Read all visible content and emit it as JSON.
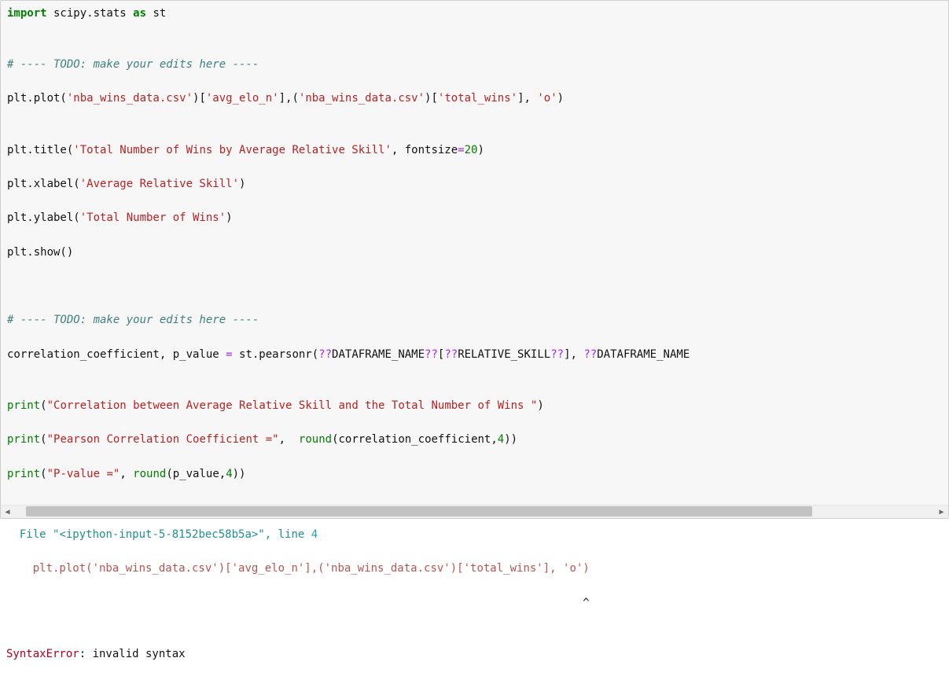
{
  "code": {
    "l1_import": "import",
    "l1_mod": " scipy.stats ",
    "l1_as": "as",
    "l1_alias": " st",
    "blank": "",
    "l3_cmt": "# ---- TODO: make your edits here ----",
    "l4_a": "plt.plot(",
    "l4_s1": "'nba_wins_data.csv'",
    "l4_b": ")[",
    "l4_s2": "'avg_elo_n'",
    "l4_c": "],(",
    "l4_s3": "'nba_wins_data.csv'",
    "l4_d": ")[",
    "l4_s4": "'total_wins'",
    "l4_e": "], ",
    "l4_s5": "'o'",
    "l4_f": ")",
    "l6_a": "plt.title(",
    "l6_s1": "'Total Number of Wins by Average Relative Skill'",
    "l6_b": ", fontsize",
    "l6_op": "=",
    "l6_num": "20",
    "l6_c": ")",
    "l7_a": "plt.xlabel(",
    "l7_s1": "'Average Relative Skill'",
    "l7_b": ")",
    "l8_a": "plt.ylabel(",
    "l8_s1": "'Total Number of Wins'",
    "l8_b": ")",
    "l9": "plt.show()",
    "l12_cmt": "# ---- TODO: make your edits here ----",
    "l13_a": "correlation_coefficient, p_value ",
    "l13_op": "=",
    "l13_b": " st.pearsonr(",
    "l13_op2": "??",
    "l13_c": "DATAFRAME_NAME",
    "l13_op3": "??",
    "l13_d": "[",
    "l13_op4": "??",
    "l13_e": "RELATIVE_SKILL",
    "l13_op5": "??",
    "l13_f": "], ",
    "l13_op6": "??",
    "l13_g": "DATAFRAME_NAME",
    "l15_a": "print",
    "l15_p": "(",
    "l15_s1": "\"Correlation between Average Relative Skill and the Total Number of Wins \"",
    "l15_b": ")",
    "l16_a": "print",
    "l16_p": "(",
    "l16_s1": "\"Pearson Correlation Coefficient =\"",
    "l16_b": ",  ",
    "l16_round": "round",
    "l16_c": "(correlation_coefficient,",
    "l16_num": "4",
    "l16_d": "))",
    "l17_a": "print",
    "l17_p": "(",
    "l17_s1": "\"P-value =\"",
    "l17_b": ", ",
    "l17_round": "round",
    "l17_c": "(p_value,",
    "l17_num": "4",
    "l17_d": "))"
  },
  "output": {
    "file_prefix": "  File ",
    "file_str": "\"<ipython-input-5-8152bec58b5a>\"",
    "file_mid": ", line ",
    "file_line": "4",
    "src_indent": "    ",
    "src": "plt.plot('nba_wins_data.csv')['avg_elo_n'],('nba_wins_data.csv')['total_wins'], 'o')",
    "caret": "                                                                                       ^",
    "err_name": "SyntaxError",
    "err_sep": ": ",
    "err_msg": "invalid syntax"
  }
}
